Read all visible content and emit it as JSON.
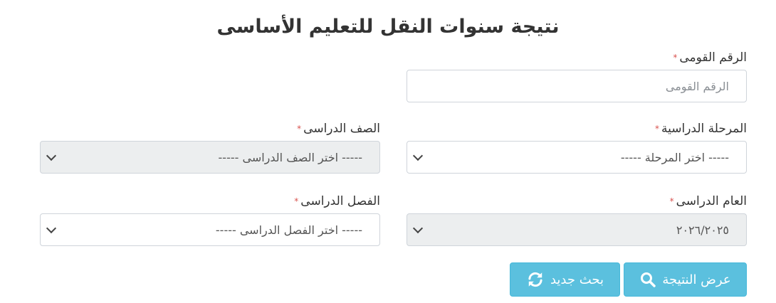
{
  "page": {
    "title": "نتيجة سنوات النقل للتعليم الأساسى"
  },
  "form": {
    "national_id": {
      "label": "الرقم القومى",
      "placeholder": "الرقم القومى",
      "value": ""
    },
    "stage": {
      "label": "المرحلة الدراسية",
      "selected": "----- اختر المرحلة -----"
    },
    "grade": {
      "label": "الصف الدراسى",
      "selected": "----- اختر الصف الدراسى -----"
    },
    "year": {
      "label": "العام الدراسى",
      "selected": "٢٠٢٦/٢٠٢٥"
    },
    "term": {
      "label": "الفصل الدراسى",
      "selected": "----- اختر الفصل الدراسى -----"
    },
    "required_mark": "*"
  },
  "actions": {
    "show_result": {
      "label": "عرض النتيجة",
      "icon": "search-icon"
    },
    "new_search": {
      "label": "بحث جديد",
      "icon": "refresh-icon"
    }
  },
  "colors": {
    "button": "#5bc0de",
    "required": "#d9534f",
    "disabled_bg": "#eceeef",
    "border": "#cfd4da"
  }
}
